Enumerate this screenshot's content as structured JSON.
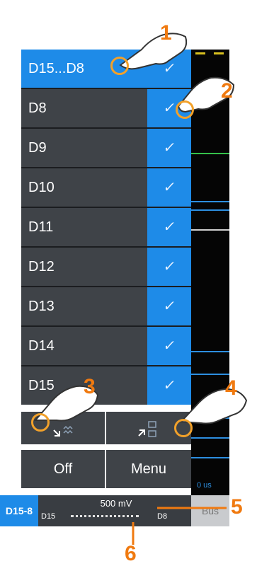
{
  "channels": [
    {
      "label": "D15...D8",
      "checked": true,
      "selected": true
    },
    {
      "label": "D8",
      "checked": true
    },
    {
      "label": "D9",
      "checked": true
    },
    {
      "label": "D10",
      "checked": true
    },
    {
      "label": "D11",
      "checked": true
    },
    {
      "label": "D12",
      "checked": true
    },
    {
      "label": "D13",
      "checked": true
    },
    {
      "label": "D14",
      "checked": true
    },
    {
      "label": "D15",
      "checked": true
    }
  ],
  "check_glyph": "✓",
  "buttons": {
    "off_label": "Off",
    "menu_label": "Menu",
    "collapse_icon": "collapse-traces-icon",
    "expand_icon": "expand-traces-icon"
  },
  "bus_bar": {
    "label": "D15-8",
    "scale": "500 mV",
    "msb": "D15",
    "lsb": "D8",
    "bus_button": "Bus"
  },
  "scope": {
    "timebase_text": "0 us"
  },
  "callouts": [
    "1",
    "2",
    "3",
    "4",
    "5",
    "6"
  ],
  "colors": {
    "accent": "#1e8be8",
    "row_bg": "#3f4348",
    "callout": "#f07a10",
    "trace_green": "#35c24a",
    "trace_blue": "#2d8fe0"
  }
}
